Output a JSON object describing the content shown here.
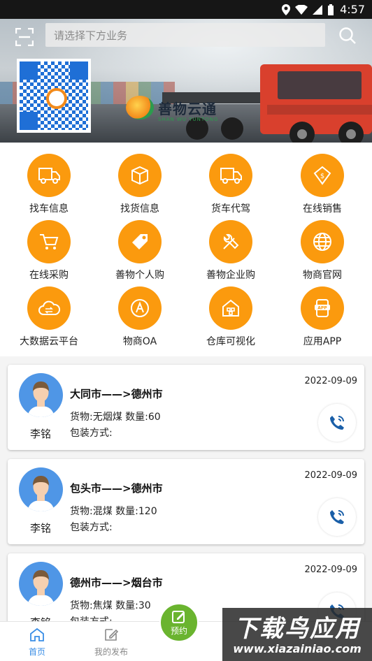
{
  "status_bar": {
    "time": "4:57"
  },
  "header": {
    "search_placeholder": "请选择下方业务"
  },
  "banner": {
    "brand_name": "善物云通",
    "brand_sub": "SHAN WU YUNTONG"
  },
  "menu": [
    {
      "label": "找车信息",
      "icon": "truck-icon"
    },
    {
      "label": "找货信息",
      "icon": "box-icon"
    },
    {
      "label": "货车代驾",
      "icon": "truck-icon"
    },
    {
      "label": "在线销售",
      "icon": "price-tag-icon"
    },
    {
      "label": "在线采购",
      "icon": "cart-icon"
    },
    {
      "label": "善物个人购",
      "icon": "tag-icon"
    },
    {
      "label": "善物企业购",
      "icon": "tools-icon"
    },
    {
      "label": "物商官网",
      "icon": "globe-icon"
    },
    {
      "label": "大数据云平台",
      "icon": "cloud-icon"
    },
    {
      "label": "物商OA",
      "icon": "a-circle-icon"
    },
    {
      "label": "仓库可视化",
      "icon": "warehouse-icon"
    },
    {
      "label": "应用APP",
      "icon": "app-icon"
    }
  ],
  "cards": [
    {
      "name": "李铭",
      "route": "大同市——>德州市",
      "goods": "货物:无烟煤  数量:60",
      "pack": "包装方式:",
      "date": "2022-09-09"
    },
    {
      "name": "李铭",
      "route": "包头市——>德州市",
      "goods": "货物:混煤  数量:120",
      "pack": "包装方式:",
      "date": "2022-09-09"
    },
    {
      "name": "李铭",
      "route": "德州市——>烟台市",
      "goods": "货物:焦煤  数量:30",
      "pack": "包装方式:",
      "date": "2022-09-09"
    }
  ],
  "tabs": {
    "home": "首页",
    "publish": "我的发布",
    "reserve": "预约"
  },
  "colors": {
    "accent": "#fb9a0e",
    "tab_active": "#3a8ee6",
    "fab": "#6ab42f"
  },
  "watermark": {
    "big": "下载鸟应用",
    "url": "www.xiazainiao.com"
  }
}
